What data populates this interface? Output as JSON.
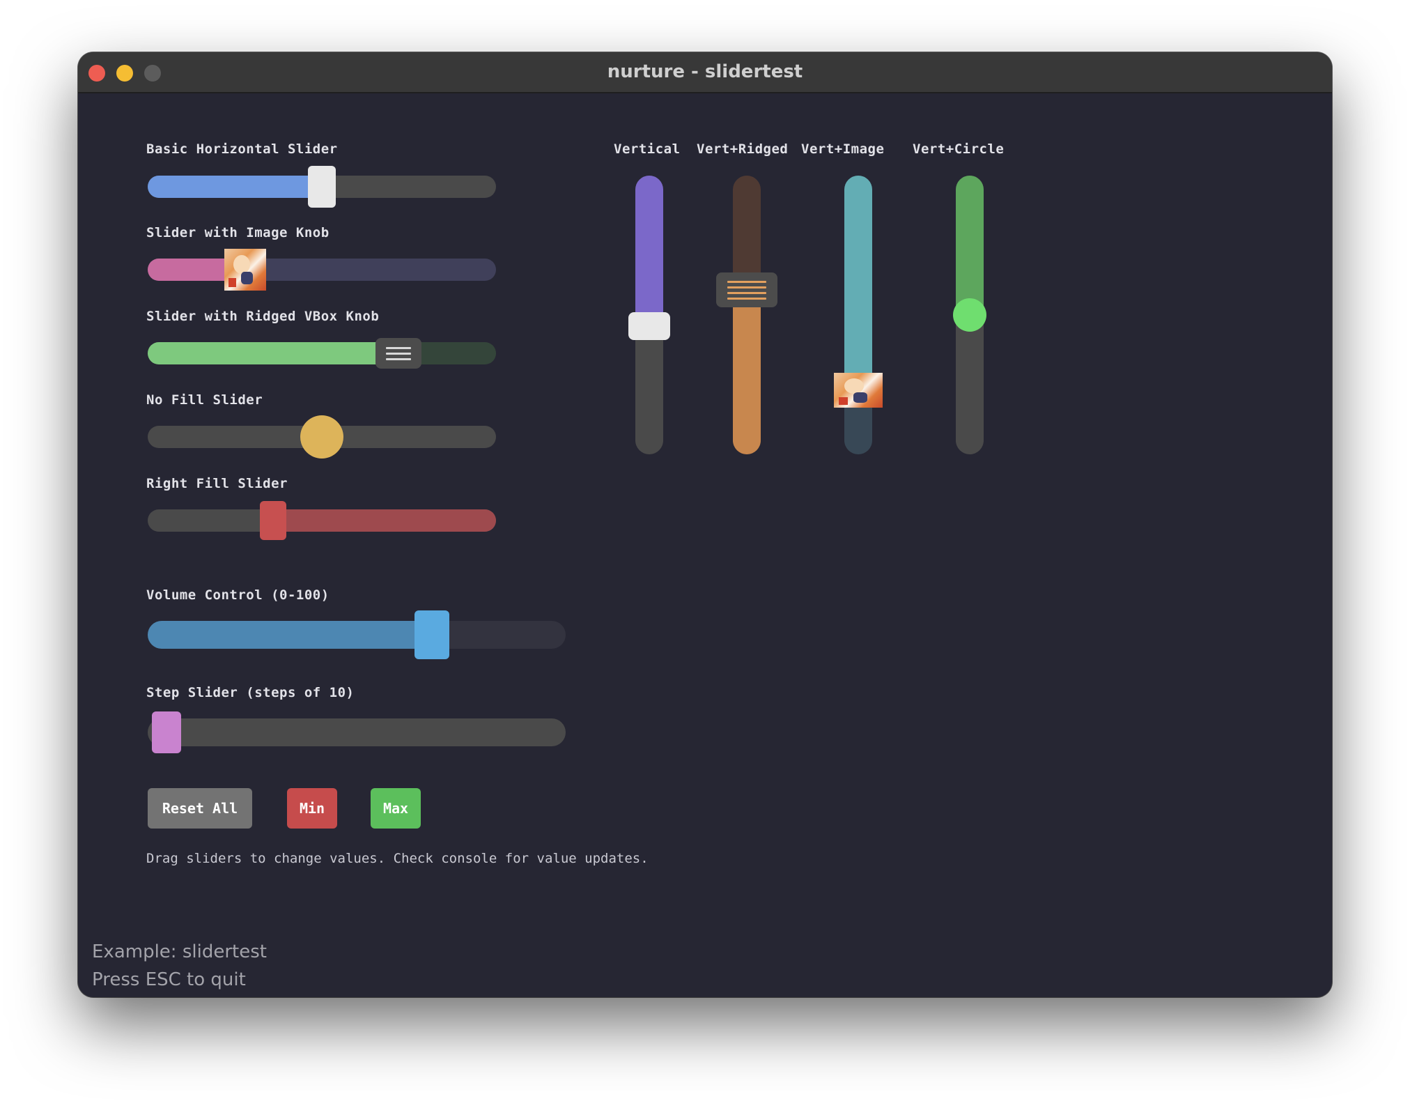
{
  "window": {
    "title": "nurture - slidertest"
  },
  "sliders": [
    {
      "label": "Basic Horizontal Slider",
      "value": 0.5,
      "fill": "left",
      "fill_color": "#6e98e0",
      "track_color": "#4a4a4a",
      "knob_color": "#e8e8e8",
      "knob": "rect"
    },
    {
      "label": "Slider with Image Knob",
      "value": 0.28,
      "fill": "left",
      "fill_color": "#c76b9f",
      "track_color": "#40405a",
      "knob": "image"
    },
    {
      "label": "Slider with Ridged VBox Knob",
      "value": 0.72,
      "fill": "left",
      "fill_color": "#7ec97e",
      "track_color": "#34453a",
      "knob_color": "#4c4c4c",
      "knob": "ridged"
    },
    {
      "label": "No Fill Slider",
      "value": 0.5,
      "fill": "none",
      "track_color": "#4a4a4a",
      "knob_color": "#ddb45a",
      "knob": "circle"
    },
    {
      "label": "Right Fill Slider",
      "value": 0.36,
      "fill": "right",
      "fill_color": "#9e4a4e",
      "track_color": "#4a4a4a",
      "knob_color": "#c75050",
      "knob": "rect"
    },
    {
      "label": "Volume Control (0-100)",
      "value": 0.68,
      "fill": "left",
      "fill_color": "#4d87b2",
      "track_color": "#33333f",
      "knob_color": "#5aaae0",
      "knob": "rect"
    },
    {
      "label": "Step Slider (steps of 10)",
      "value": 0.0,
      "fill": "left",
      "fill_color": "#a37aaa",
      "track_color": "#4a4a4a",
      "knob_color": "#c983cf",
      "knob": "rect"
    }
  ],
  "vertical_sliders": [
    {
      "label": "Vertical",
      "value": 0.46,
      "fill_color": "#7b68c9",
      "track_color": "#4a4a4a",
      "knob_color": "#e8e8e8",
      "knob": "rect"
    },
    {
      "label": "Vert+Ridged",
      "value": 0.59,
      "fill_color": "#c8874e",
      "track_color": "#4f3a33",
      "fill": "bottom",
      "knob_color": "#4c4c4c",
      "knob": "ridged"
    },
    {
      "label": "Vert+Image",
      "value": 0.23,
      "fill_color": "#63adb4",
      "track_color": "#384856",
      "knob": "image"
    },
    {
      "label": "Vert+Circle",
      "value": 0.5,
      "fill_color": "#5da65d",
      "track_color": "#4a4a4a",
      "knob_color": "#6fde6f",
      "knob": "circle"
    }
  ],
  "buttons": [
    {
      "label": "Reset All",
      "color": "#737373"
    },
    {
      "label": "Min",
      "color": "#c64c4c"
    },
    {
      "label": "Max",
      "color": "#5cbf5c"
    }
  ],
  "hint": "Drag sliders to change values. Check console for value updates.",
  "footer": {
    "line1": "Example: slidertest",
    "line2": "Press ESC to quit"
  }
}
